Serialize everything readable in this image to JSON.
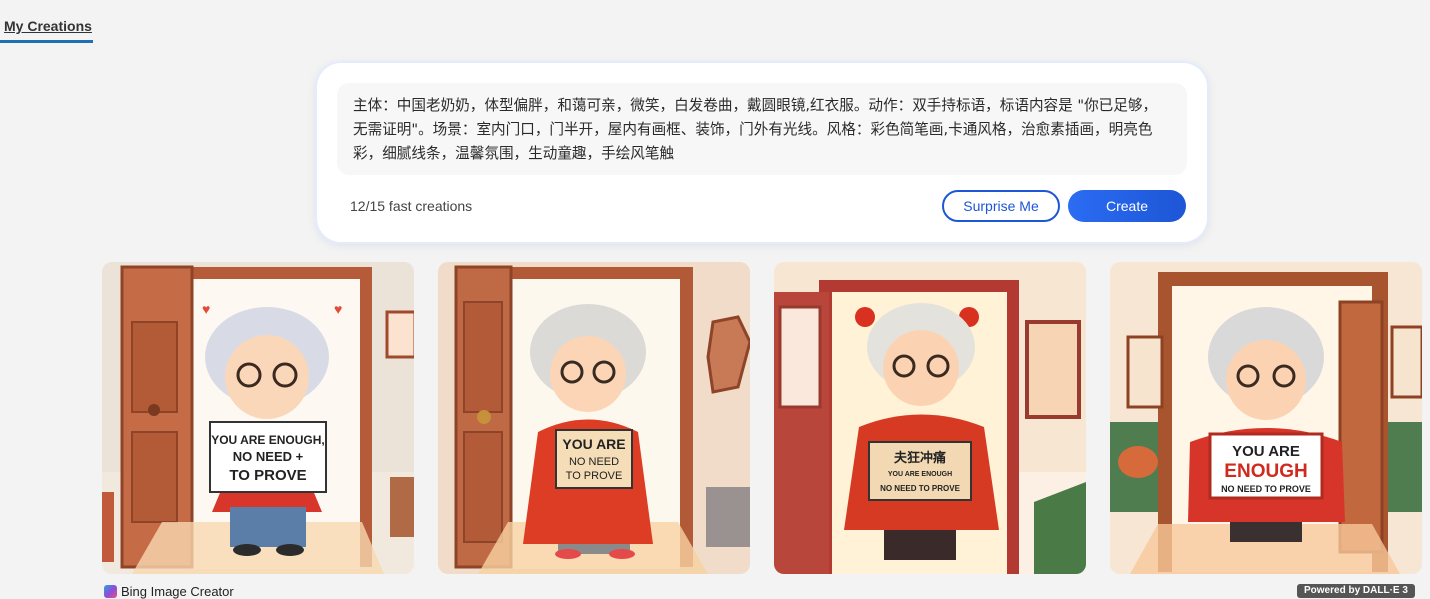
{
  "tabs": {
    "my_creations": "My Creations"
  },
  "prompt": {
    "text": "主体：中国老奶奶，体型偏胖，和蔼可亲，微笑，白发卷曲，戴圆眼镜,红衣服。动作：双手持标语，标语内容是 \"你已足够，无需证明\"。场景：室内门口，门半开，屋内有画框、装饰，门外有光线。风格：彩色简笔画,卡通风格，治愈素插画，明亮色彩，细腻线条，温馨氛围，生动童趣，手绘风笔触"
  },
  "counter": "12/15 fast creations",
  "buttons": {
    "surprise": "Surprise Me",
    "create": "Create"
  },
  "images": [
    {
      "sign": [
        "YOU ARE ENOUGH,",
        "NO NEED +",
        "TO PROVE"
      ],
      "door_color": "#b85c3a",
      "bg": "#f4eadf"
    },
    {
      "sign": [
        "YOU ARE",
        "NO NEED",
        "TO PROVE"
      ],
      "door_color": "#b55a35",
      "bg": "#f0dcc8"
    },
    {
      "sign": [
        "夫狂冲痛",
        "YOU ARE ENOUGH",
        "NO NEED TO PROVE"
      ],
      "door_color": "#b2413a",
      "bg": "#f6e7cf"
    },
    {
      "sign": [
        "YOU ARE",
        "ENOUGH",
        "NO NEED TO PROVE"
      ],
      "door_color": "#a9542f",
      "bg": "#f3e4d0"
    }
  ],
  "footer": {
    "brand": "Bing Image Creator",
    "powered": "Powered by DALL·E 3"
  }
}
